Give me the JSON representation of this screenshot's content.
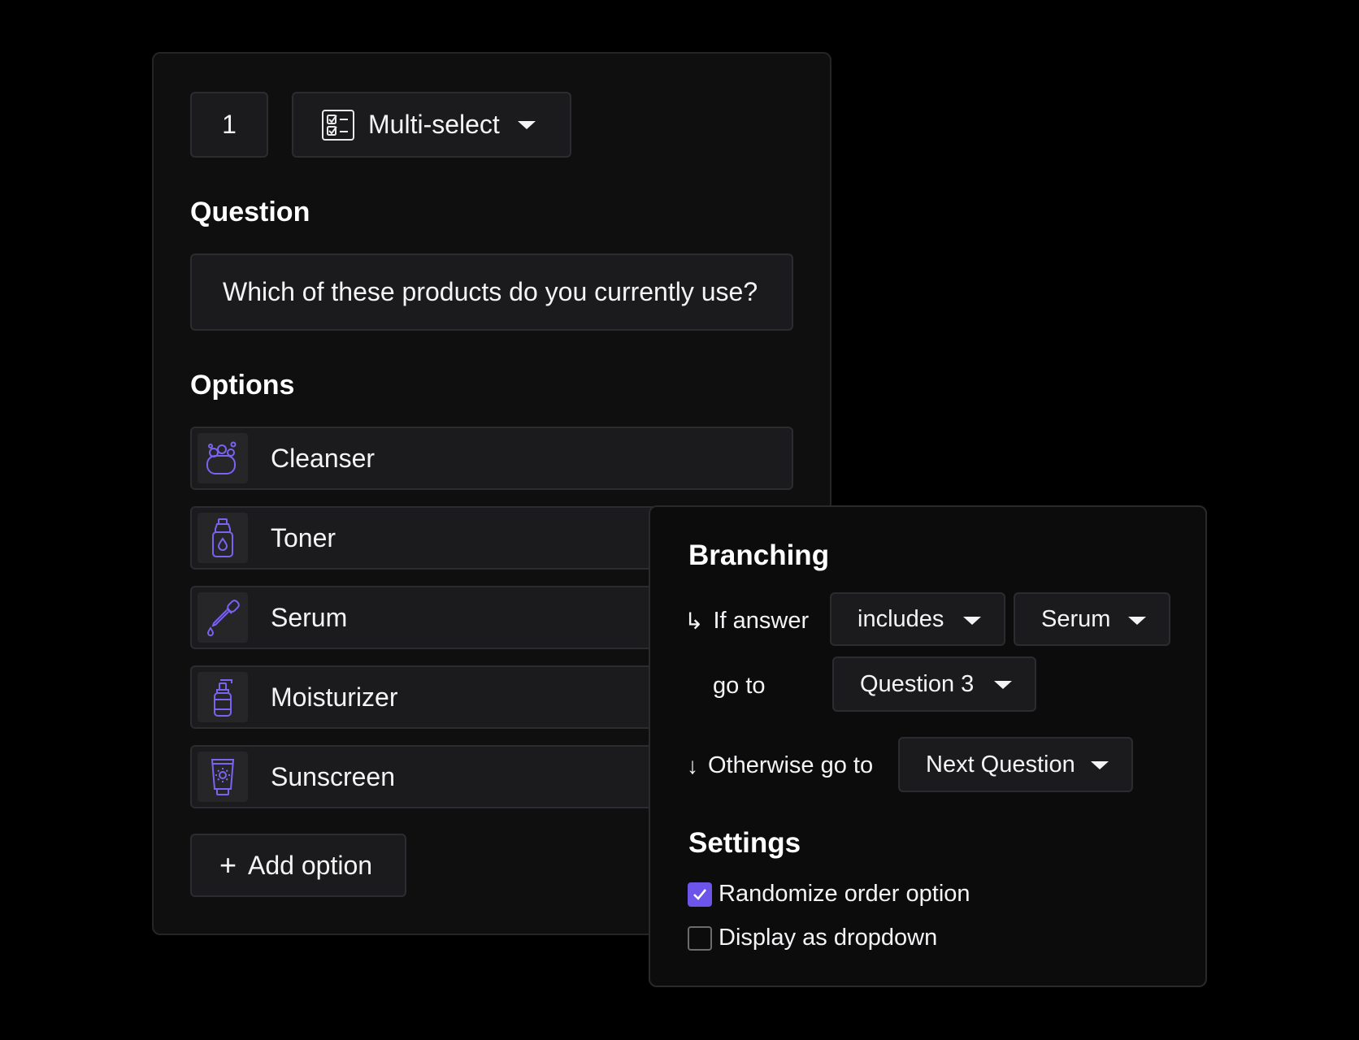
{
  "question_card": {
    "number": "1",
    "type_label": "Multi-select",
    "type_icon": "checklist-icon",
    "question_heading": "Question",
    "question_text": "Which of these products do you currently use?",
    "options_heading": "Options",
    "options": [
      {
        "label": "Cleanser",
        "icon": "soap-bubbles-icon"
      },
      {
        "label": "Toner",
        "icon": "toner-bottle-icon"
      },
      {
        "label": "Serum",
        "icon": "dropper-icon"
      },
      {
        "label": "Moisturizer",
        "icon": "pump-bottle-icon"
      },
      {
        "label": "Sunscreen",
        "icon": "sunscreen-tube-icon"
      }
    ],
    "add_option_label": "Add option"
  },
  "branching_panel": {
    "heading": "Branching",
    "if_answer_label": "If answer",
    "condition": "includes",
    "answer_value": "Serum",
    "go_to_label": "go to",
    "go_to_target": "Question 3",
    "otherwise_label": "Otherwise go to",
    "otherwise_target": "Next Question",
    "settings_heading": "Settings",
    "settings": [
      {
        "label": "Randomize order option",
        "checked": true
      },
      {
        "label": "Display as dropdown",
        "checked": false
      }
    ]
  },
  "colors": {
    "accent": "#6c55e8",
    "background": "#000000",
    "card": "#0f0f10",
    "field": "#1b1b1d",
    "icon_stroke": "#7b63f0"
  }
}
